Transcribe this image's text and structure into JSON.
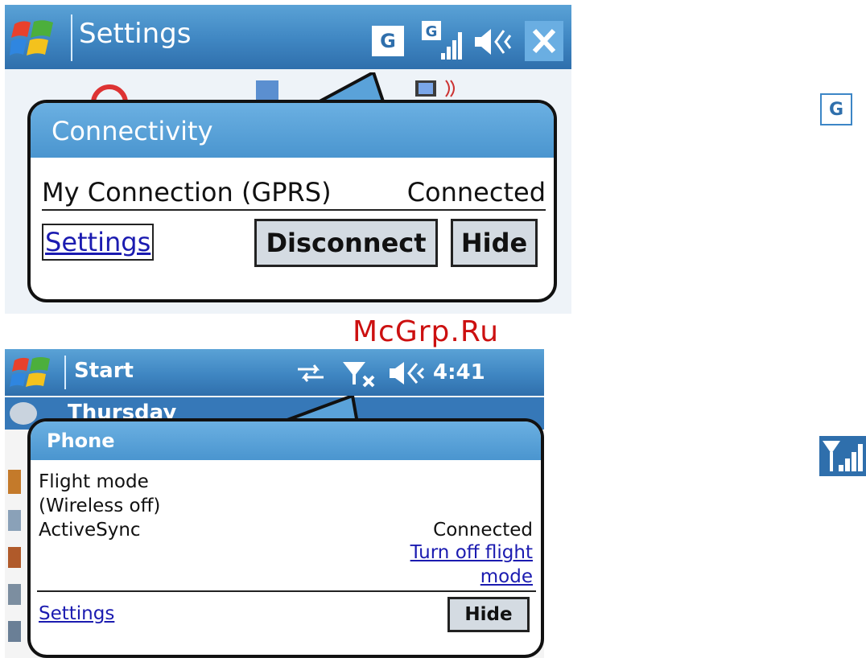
{
  "screen1": {
    "title": "Settings",
    "status_icons": [
      "g-data-icon",
      "g-signal-icon",
      "speaker-icon",
      "close-icon"
    ],
    "status_g": "G",
    "popup": {
      "title": "Connectivity",
      "connection_name": "My Connection (GPRS)",
      "connection_status": "Connected",
      "settings_link": "Settings",
      "disconnect_button": "Disconnect",
      "hide_button": "Hide"
    }
  },
  "watermark": "McGrp.Ru",
  "screen2": {
    "title": "Start",
    "clock": "4:41",
    "status_icons": [
      "sync-arrows-icon",
      "signal-off-icon",
      "speaker-icon"
    ],
    "background_text": "Thursday",
    "popup": {
      "title": "Phone",
      "flight_mode_line1": "Flight mode",
      "flight_mode_line2": "(Wireless off)",
      "activesync_label": "ActiveSync",
      "activesync_status": "Connected",
      "turn_off_line1": "Turn off flight",
      "turn_off_line2": "mode",
      "settings_link": "Settings",
      "hide_button": "Hide"
    }
  },
  "legend_icons": {
    "gprs_label": "G"
  },
  "colors": {
    "titlebar": "#3f86c2",
    "popup_header": "#5aa2d9",
    "link": "#1b1bb0",
    "button_face": "#d4dbe2",
    "watermark": "#cc1010"
  }
}
